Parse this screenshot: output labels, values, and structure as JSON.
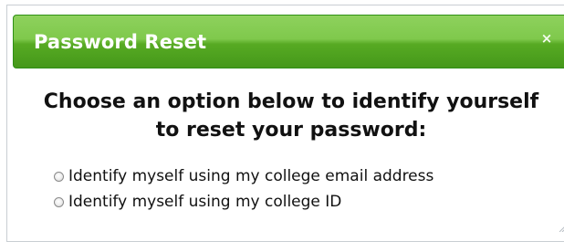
{
  "dialog": {
    "title": "Password Reset",
    "close_icon": "close-icon",
    "heading": "Choose an option below to identify yourself to reset your password:",
    "options": [
      {
        "label": "Identify myself using my college email address",
        "selected": false
      },
      {
        "label": "Identify myself using my college ID",
        "selected": false
      }
    ],
    "accent_color": "#5cae2e"
  }
}
